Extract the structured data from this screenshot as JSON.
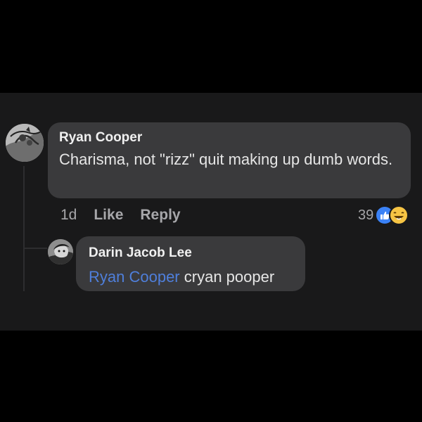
{
  "comment": {
    "author": "Ryan Cooper",
    "text": "Charisma, not \"rizz\" quit making up dumb words.",
    "time": "1d",
    "like_label": "Like",
    "reply_label": "Reply",
    "reaction_count": "39"
  },
  "reply": {
    "author": "Darin Jacob Lee",
    "mention": "Ryan Cooper",
    "text": "cryan pooper"
  },
  "colors": {
    "background": "#19191a",
    "bubble": "#3a3a3c",
    "mention": "#4f7fdb"
  },
  "icons": [
    "avatar",
    "like-reaction-icon",
    "haha-reaction-icon"
  ]
}
